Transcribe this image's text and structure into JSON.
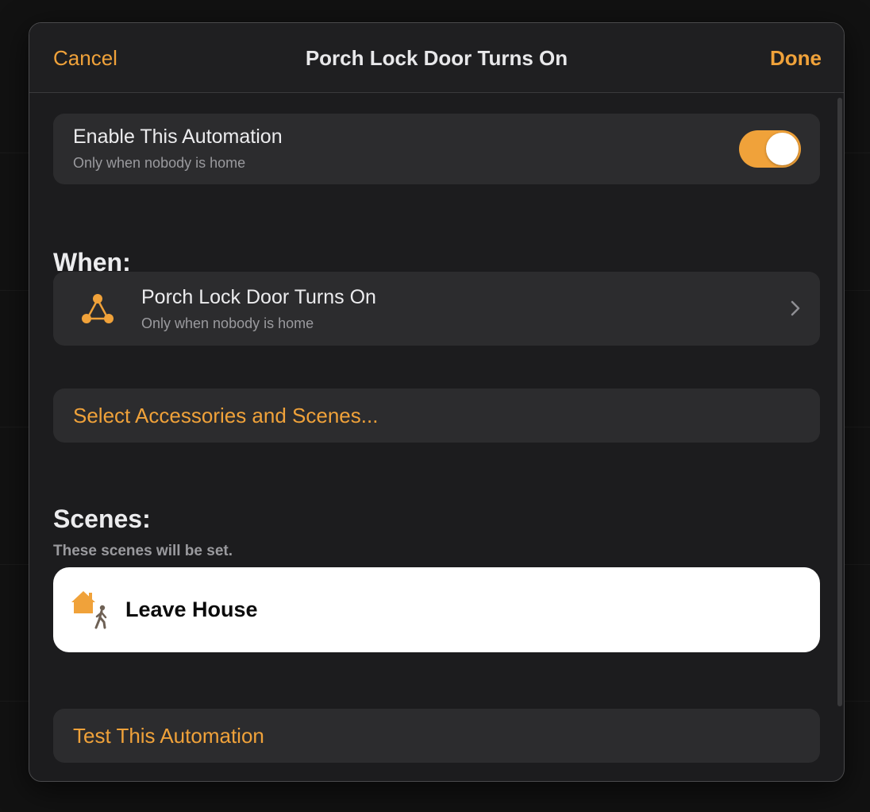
{
  "nav": {
    "cancel_label": "Cancel",
    "title": "Porch Lock Door Turns On",
    "done_label": "Done"
  },
  "enable": {
    "title": "Enable This Automation",
    "subtitle": "Only when nobody is home",
    "toggle_on": true
  },
  "when": {
    "heading": "When:",
    "trigger": {
      "icon": "automation-trigger-icon",
      "title": "Porch Lock Door Turns On",
      "subtitle": "Only when nobody is home",
      "chevron": "chevron-right-icon"
    }
  },
  "select": {
    "label": "Select Accessories and Scenes..."
  },
  "scenes": {
    "heading": "Scenes:",
    "subtitle": "These scenes will be set.",
    "items": [
      {
        "icon": "house-walking-person-icon",
        "label": "Leave House"
      }
    ]
  },
  "test": {
    "label": "Test This Automation"
  },
  "colors": {
    "accent": "#f0a23a",
    "sheet_background": "#1c1c1e",
    "card_background": "#2c2c2e",
    "scene_tile_background": "#ffffff"
  }
}
